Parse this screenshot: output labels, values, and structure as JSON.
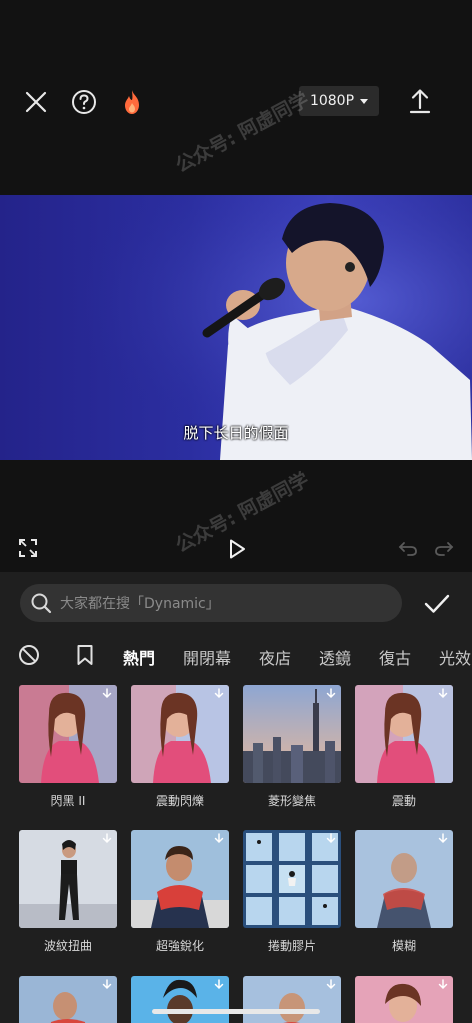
{
  "toolbar": {
    "close_icon": "close-icon",
    "help_icon": "help-icon",
    "fire_icon": "fire-icon",
    "resolution_label": "1080P",
    "export_icon": "upload-icon",
    "fire_color": "#ff6a3c"
  },
  "preview": {
    "subtitle": "脱下长日的假面"
  },
  "controls": {
    "fullscreen_icon": "fullscreen-icon",
    "play_icon": "play-icon",
    "undo_icon": "undo-icon",
    "redo_icon": "redo-icon"
  },
  "search": {
    "placeholder": "大家都在搜「Dynamic」"
  },
  "tabs": [
    "熱門",
    "開閉幕",
    "夜店",
    "透鏡",
    "復古",
    "光效"
  ],
  "effects": [
    {
      "label": "閃黑 II"
    },
    {
      "label": "震動閃爍"
    },
    {
      "label": "菱形變焦"
    },
    {
      "label": "震動"
    },
    {
      "label": "波紋扭曲"
    },
    {
      "label": "超強銳化"
    },
    {
      "label": "捲動膠片"
    },
    {
      "label": "模糊"
    }
  ],
  "watermark": "公众号: 阿虚同学"
}
